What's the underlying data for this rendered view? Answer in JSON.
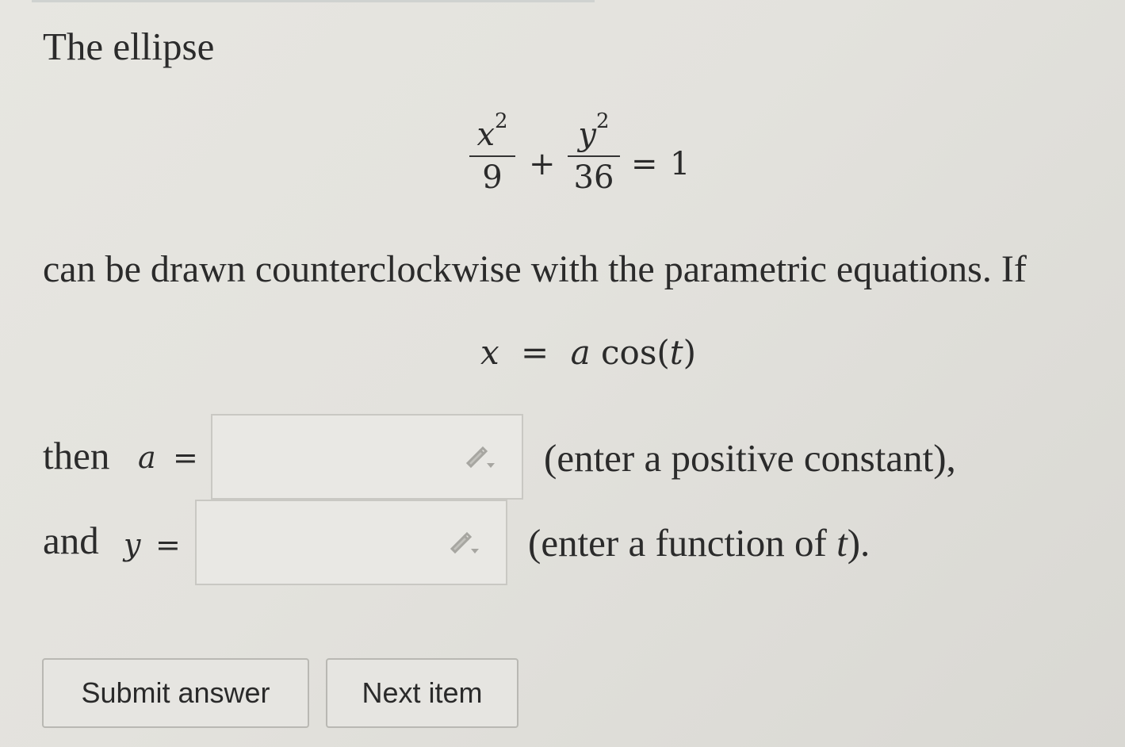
{
  "question": {
    "intro": "The ellipse",
    "equation": {
      "term1_num": "x",
      "term1_exp": "2",
      "term1_den": "9",
      "plus": "+",
      "term2_num": "y",
      "term2_exp": "2",
      "term2_den": "36",
      "equals": "=",
      "rhs": "1"
    },
    "middle_text": "can be drawn counterclockwise with the parametric equations. If",
    "param_equation": {
      "lhs": "x",
      "equals": "=",
      "coef": "a",
      "func": "cos(",
      "var": "t",
      "close": ")"
    },
    "line_a": {
      "prefix": "then",
      "var": "a",
      "equals": "=",
      "value": "",
      "hint": "(enter a positive constant),"
    },
    "line_y": {
      "prefix": "and",
      "var": "y",
      "equals": "=",
      "value": "",
      "hint_before": "(enter a function of ",
      "hint_var": "t",
      "hint_after": ")."
    }
  },
  "buttons": {
    "submit_label": "Submit answer",
    "next_label": "Next item"
  },
  "icons": {
    "edit": "pencil-dropdown-icon"
  },
  "colors": {
    "background": "#e4e3de",
    "text": "#2b2b2b",
    "border": "#c9c8c3"
  }
}
